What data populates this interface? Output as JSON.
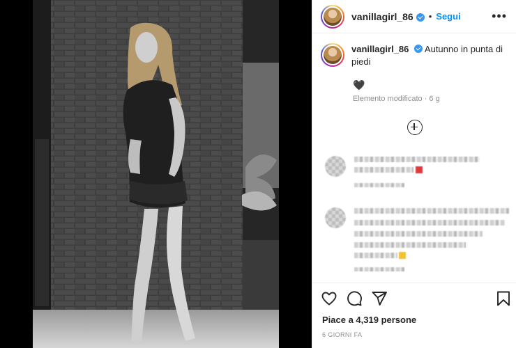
{
  "post": {
    "username": "vanillagirl_86",
    "follow_label": "Segui",
    "separator": "•",
    "more_label": "•••",
    "caption_text": "Autunno in punta di piedi",
    "caption_emoji": "🖤",
    "caption_meta": "Elemento modificato · 6 g",
    "likes_text": "Piace a 4,319 persone",
    "age_text": "6 GIORNI FA"
  },
  "icons": {
    "verified": "verified-badge-icon",
    "more": "more-options-icon",
    "load_more": "plus-circle-icon",
    "like": "heart-icon",
    "comment": "comment-bubble-icon",
    "share": "paper-plane-icon",
    "save": "bookmark-icon"
  },
  "colors": {
    "link_blue": "#0095f6",
    "verified_blue": "#3897f0",
    "text": "#262626",
    "meta_grey": "#8e8e8e"
  }
}
